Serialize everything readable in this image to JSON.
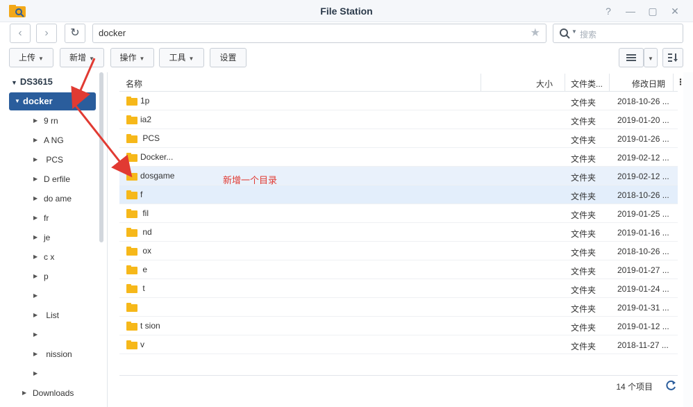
{
  "window": {
    "title": "File Station",
    "controls": [
      "?",
      "—",
      "▢",
      "✕"
    ]
  },
  "navigation": {
    "path": "docker",
    "search_placeholder": "搜索"
  },
  "toolbar": {
    "upload": "上传",
    "create": "新增",
    "action": "操作",
    "tools": "工具",
    "settings": "设置"
  },
  "sidebar": {
    "root": "DS3615",
    "selected": "docker",
    "items": [
      "9‍ ‍rn",
      "A‍ ‍NG",
      "‍ ‍PCS",
      "D‍ ‍erfile",
      "do‍ ‍ame",
      "fr‍ ‍",
      "je‍ ‍",
      "c‍ ‍x",
      "p‍ ‍",
      "‍ ‍",
      "‍ ‍List",
      "‍ ‍",
      "‍ ‍nission",
      "‍ ‍"
    ],
    "downloads": "Downloads"
  },
  "grid": {
    "headers": {
      "name": "名称",
      "size": "大小",
      "type": "文件类...",
      "modified": "修改日期"
    },
    "rows": [
      {
        "name": "1p‍ ‍",
        "type": "文件夹",
        "date": "2018-10-26 ..."
      },
      {
        "name": "ia2‍ ‍",
        "type": "文件夹",
        "date": "2019-01-20 ..."
      },
      {
        "name": "‍ ‍PCS",
        "type": "文件夹",
        "date": "2019-01-26 ..."
      },
      {
        "name": "Docker...",
        "type": "文件夹",
        "date": "2019-02-12 ..."
      },
      {
        "name": "dosgame",
        "type": "文件夹",
        "date": "2019-02-12 ..."
      },
      {
        "name": "f‍ ‍",
        "type": "文件夹",
        "date": "2018-10-26 ..."
      },
      {
        "name": "‍ ‍fil‍ ‍",
        "type": "文件夹",
        "date": "2019-01-25 ..."
      },
      {
        "name": "‍ ‍nd‍ ‍",
        "type": "文件夹",
        "date": "2019-01-16 ..."
      },
      {
        "name": "‍ ‍ox‍ ‍",
        "type": "文件夹",
        "date": "2018-10-26 ..."
      },
      {
        "name": "‍ ‍e",
        "type": "文件夹",
        "date": "2019-01-27 ..."
      },
      {
        "name": "‍ ‍t",
        "type": "文件夹",
        "date": "2019-01-24 ..."
      },
      {
        "name": "‍ ‍",
        "type": "文件夹",
        "date": "2019-01-31 ..."
      },
      {
        "name": "t‍ ‍sion",
        "type": "文件夹",
        "date": "2019-01-12 ..."
      },
      {
        "name": "v‍ ‍",
        "type": "文件夹",
        "date": "2018-11-27 ..."
      }
    ]
  },
  "status": {
    "count": "14 个项目"
  },
  "annotation": {
    "text": "新增一个目录"
  },
  "colors": {
    "selected": "#2a5d9c",
    "folder": "#f6b81a",
    "annotation": "#e13a32"
  }
}
